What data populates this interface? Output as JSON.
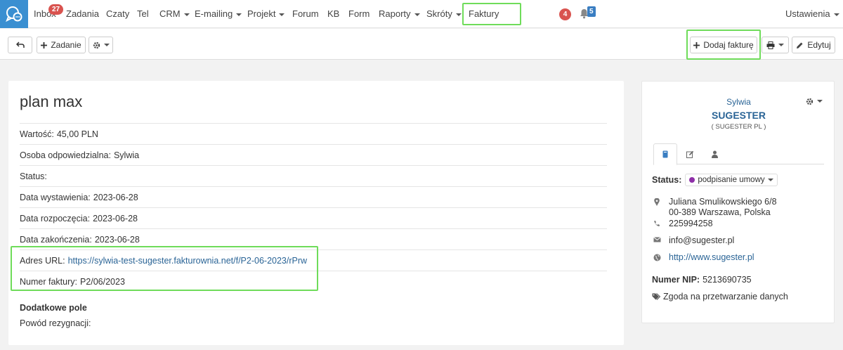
{
  "nav": {
    "items": [
      {
        "label": "Inbox",
        "dropdown": false
      },
      {
        "label": "Zadania",
        "dropdown": false
      },
      {
        "label": "Czaty",
        "dropdown": false
      },
      {
        "label": "Tel",
        "dropdown": false
      },
      {
        "label": "CRM",
        "dropdown": true
      },
      {
        "label": "E-mailing",
        "dropdown": true
      },
      {
        "label": "Projekt",
        "dropdown": true
      },
      {
        "label": "Forum",
        "dropdown": false
      },
      {
        "label": "KB",
        "dropdown": false
      },
      {
        "label": "Form",
        "dropdown": false
      },
      {
        "label": "Raporty",
        "dropdown": true
      },
      {
        "label": "Skróty",
        "dropdown": true
      },
      {
        "label": "Faktury",
        "dropdown": false
      }
    ],
    "inbox_badge": "27",
    "alerts_badge": "4",
    "notifications_badge": "5",
    "settings_label": "Ustawienia"
  },
  "toolbar": {
    "task_label": "Zadanie",
    "add_invoice_label": "Dodaj fakturę",
    "edit_label": "Edytuj"
  },
  "invoice": {
    "title": "plan max",
    "fields": [
      {
        "label": "Wartość:",
        "value": "45,00 PLN"
      },
      {
        "label": "Osoba odpowiedzialna:",
        "value": "Sylwia"
      },
      {
        "label": "Status:",
        "value": ""
      },
      {
        "label": "Data wystawienia:",
        "value": "2023-06-28"
      },
      {
        "label": "Data rozpoczęcia:",
        "value": "2023-06-28"
      },
      {
        "label": "Data zakończenia:",
        "value": "2023-06-28"
      },
      {
        "label": "Adres URL:",
        "value": "https://sylwia-test-sugester.fakturownia.net/f/P2-06-2023/rPrw"
      },
      {
        "label": "Numer faktury:",
        "value": "P2/06/2023"
      }
    ],
    "extra_heading": "Dodatkowe pole",
    "extra_field_label": "Powód rezygnacji:"
  },
  "client": {
    "person": "Sylwia",
    "company": "SUGESTER",
    "company_full": "( SUGESTER PL )",
    "status_label": "Status:",
    "status_value": "podpisanie umowy",
    "status_color": "#8e2fa8",
    "address_line1": "Juliana Smulikowskiego 6/8",
    "address_line2": "00-389 Warszawa, Polska",
    "phone": "225994258",
    "email": "info@sugester.pl",
    "website": "http://www.sugester.pl",
    "nip_label": "Numer NIP:",
    "nip_value": "5213690735",
    "consent_label": "Zgoda na przetwarzanie danych"
  },
  "colors": {
    "accent": "#3a8fd1",
    "highlight": "#6fdc5a",
    "link": "#2a6496"
  }
}
